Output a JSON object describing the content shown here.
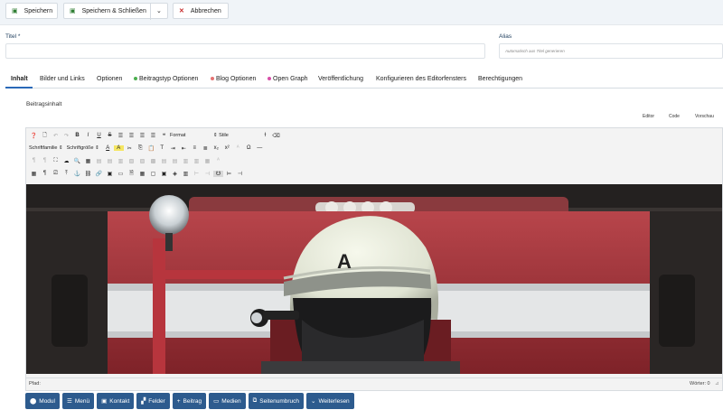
{
  "toolbar": {
    "save_label": "Speichern",
    "save_close_label": "Speichern & Schließen",
    "cancel_label": "Abbrechen"
  },
  "form": {
    "title_label": "Titel *",
    "title_value": "",
    "alias_label": "Alias",
    "alias_placeholder": "Automatisch aus Titel generieren"
  },
  "tabs": [
    {
      "label": "Inhalt",
      "active": true
    },
    {
      "label": "Bilder und Links"
    },
    {
      "label": "Optionen"
    },
    {
      "label": "Beitragstyp Optionen",
      "dot": "#4caf50"
    },
    {
      "label": "Blog Optionen",
      "dot": "#e57373"
    },
    {
      "label": "Open Graph",
      "dot": "#d84fa8"
    },
    {
      "label": "Veröffentlichung"
    },
    {
      "label": "Konfigurieren des Editorfensters"
    },
    {
      "label": "Berechtigungen"
    }
  ],
  "editor": {
    "label": "Beitragsinhalt",
    "modes": [
      "Editor",
      "Code",
      "Vorschau"
    ],
    "format_select": "Format",
    "style_select": "Stile",
    "font_family_select": "Schriftfamilie",
    "font_size_select": "Schriftgröße",
    "status_path": "Pfad:",
    "word_count": "Wörter: 0"
  },
  "image": {
    "helmet_letter": "A"
  },
  "insert_buttons": [
    {
      "label": "Modul",
      "icon": "module-icon"
    },
    {
      "label": "Menü",
      "icon": "list-icon"
    },
    {
      "label": "Kontakt",
      "icon": "contact-icon"
    },
    {
      "label": "Felder",
      "icon": "fields-icon"
    },
    {
      "label": "Beitrag",
      "icon": "plus-icon"
    },
    {
      "label": "Medien",
      "icon": "image-icon"
    },
    {
      "label": "Seitenumbruch",
      "icon": "copy-icon"
    },
    {
      "label": "Weiterlesen",
      "icon": "chevron-down-icon"
    }
  ]
}
